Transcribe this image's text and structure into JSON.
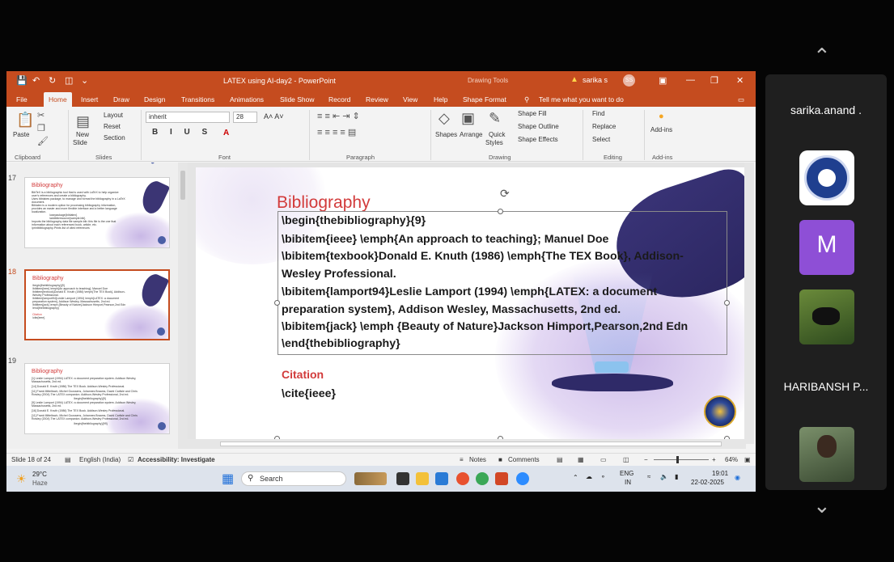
{
  "window": {
    "doc_title": "LATEX using AI-day2 - PowerPoint",
    "drawing_tools": "Drawing Tools",
    "user_name": "sarika s",
    "user_initials": "SS"
  },
  "tabs": [
    "File",
    "Home",
    "Insert",
    "Draw",
    "Design",
    "Transitions",
    "Animations",
    "Slide Show",
    "Record",
    "Review",
    "View",
    "Help",
    "Shape Format"
  ],
  "tell_me": "Tell me what you want to do",
  "ribbon": {
    "paste": "Paste",
    "layout": "Layout",
    "reset": "Reset",
    "new_slide": "New",
    "new_slide2": "Slide",
    "section": "Section",
    "font_name": "inherit",
    "font_size": "28",
    "shapes": "Shapes",
    "arrange": "Arrange",
    "quick": "Quick",
    "styles": "Styles",
    "shape_fill": "Shape Fill",
    "shape_outline": "Shape Outline",
    "shape_effects": "Shape Effects",
    "find": "Find",
    "replace": "Replace",
    "select": "Select",
    "add_ins": "Add-ins",
    "groups": {
      "clipboard": "Clipboard",
      "slides": "Slides",
      "font": "Font",
      "paragraph": "Paragraph",
      "drawing": "Drawing",
      "editing": "Editing",
      "addins": "Add-ins"
    }
  },
  "thumbs": {
    "n17": "17",
    "n18": "18",
    "n19": "19",
    "t17_title": "Bibliography",
    "t17_lines": [
      "BibTeX is a bibliographic tool that is used with LaTeX to help organize",
      "user's references and create a bibliography.",
      "Uses bibtabes package, to manage and format the bibliography in a LaTeX",
      "document.",
      "Biblatex is a modern option for processing bibliography information,",
      "provides an easier and more flexible interface and a better language",
      "localization.",
      "\\usepackage{biblatex}",
      "\\addbibresource{sample.bib}",
      "Imports the bibliography data file sample.bib: this file is the one that",
      "information about each referenced book, article, etc.",
      "\\printbibliography-Prints list of cited references"
    ],
    "t18_title": "Bibliography",
    "t18_lines": [
      "\\begin{thebibliography}{9}",
      "\\bibitem{ieee} \\emph{An approach to teaching}; Manuel Doe",
      "\\bibitem{texbook}Donald E. Knuth (1986) \\emph{The TEX Book}, Addison-",
      "Wesley Professional.",
      "\\bibitem{lamport94}Leslie Lamport (1994) \\emph{LATEX: a document",
      "preparation system}, Addison Wesley, Massachusetts, 2nd ed.",
      "\\bibitem{jack} \\emph {Beauty of Nature}Jackson Himport,Pearson,2nd Edn",
      "\\end{thebibliography}",
      "",
      "Citation",
      "\\cite{ieee}"
    ],
    "t19_title": "Bibliography",
    "t19_lines": [
      "[1] Leslie Lamport (1994) LATEX: a document preparation system. Addison Wesley,",
      "Massachusetts, 2nd ed.",
      "[14] Donald E. Knuth (1986) The TEX Book. Addison-Wesley Professional.",
      "[11] Frank Mittelbach, Michel Goossens, Johannes Braams, David Carlisle and Chris",
      "Rowley (2004) The LATEX companion. Addison-Wesley Professional, 2nd ed.",
      "\\begin{thebibliography}{9}",
      "[9] Leslie Lamport (1994) LATEX: a document preparation system. Addison Wesley,",
      "Massachusetts, 2nd ed.",
      "[16] Donald E. Knuth (1986) The TEX Book. Addison-Wesley Professional.",
      "[11] Frank Mittelbach, Michel Goossens, Johannes Braams, David Carlisle and Chris",
      "Rowley (2004) The LATEX companion. Addison-Wesley Professional, 2nd ed.",
      "\\begin{thebibliography}{99}"
    ]
  },
  "slide": {
    "title": "Bibliography",
    "lines": [
      "\\begin{thebibliography}{9}",
      "\\bibitem{ieee} \\emph{An approach to teaching}; Manuel Doe",
      "\\bibitem{texbook}Donald E. Knuth (1986) \\emph{The TEX Book}, Addison-",
      "Wesley Professional.",
      "\\bibitem{lamport94}Leslie Lamport (1994) \\emph{LATEX: a document",
      "preparation system}, Addison Wesley, Massachusetts, 2nd ed.",
      "\\bibitem{jack} \\emph {Beauty of Nature}Jackson Himport,Pearson,2nd Edn",
      "\\end{thebibliography}"
    ],
    "citation": "Citation",
    "cite": "\\cite{ieee}"
  },
  "status": {
    "slide_count": "Slide 18 of 24",
    "language": "English (India)",
    "accessibility": "Accessibility: Investigate",
    "notes": "Notes",
    "comments": "Comments",
    "zoom": "64%"
  },
  "taskbar": {
    "temp": "29°C",
    "weather": "Haze",
    "search": "Search",
    "lang1": "ENG",
    "lang2": "IN",
    "time": "19:01",
    "date": "22-02-2025"
  },
  "participants": [
    {
      "name": "sarika.anand ."
    },
    {
      "name": "HARIBANSH P..."
    }
  ],
  "m_initial": "M",
  "colors": {
    "ppt_orange": "#c54c1f",
    "title_red": "#d23b3b",
    "m_purple": "#8e4fd6"
  }
}
